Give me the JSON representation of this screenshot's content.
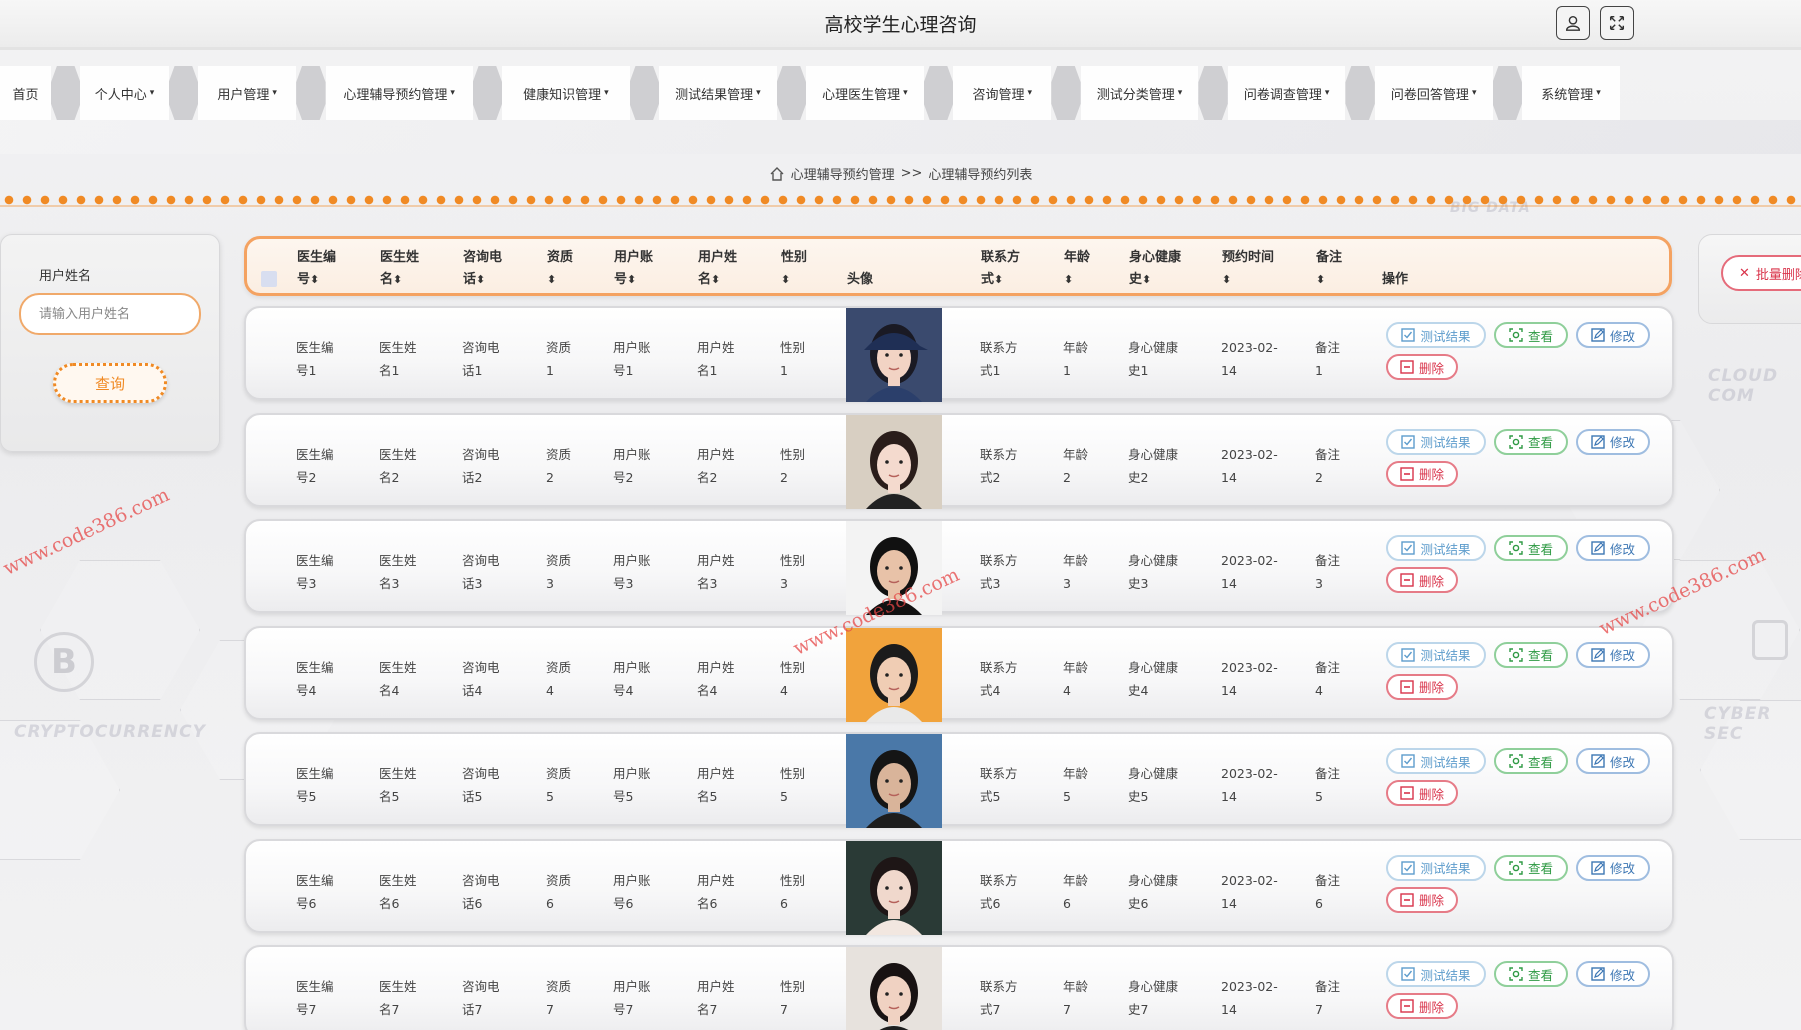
{
  "app": {
    "title": "高校学生心理咨询"
  },
  "nav": [
    {
      "label": "首页",
      "has_caret": false
    },
    {
      "label": "个人中心",
      "has_caret": true
    },
    {
      "label": "用户管理",
      "has_caret": true
    },
    {
      "label": "心理辅导预约管理",
      "has_caret": true
    },
    {
      "label": "健康知识管理",
      "has_caret": true
    },
    {
      "label": "测试结果管理",
      "has_caret": true
    },
    {
      "label": "心理医生管理",
      "has_caret": true
    },
    {
      "label": "咨询管理",
      "has_caret": true
    },
    {
      "label": "测试分类管理",
      "has_caret": true
    },
    {
      "label": "问卷调查管理",
      "has_caret": true
    },
    {
      "label": "问卷回答管理",
      "has_caret": true
    },
    {
      "label": "系统管理",
      "has_caret": true
    }
  ],
  "breadcrumb": {
    "section": "心理辅导预约管理",
    "separator": ">>",
    "page": "心理辅导预约列表"
  },
  "search": {
    "label": "用户姓名",
    "placeholder": "请输入用户姓名",
    "button": "查询"
  },
  "batch_delete": {
    "label": "批量删除"
  },
  "table": {
    "headers": [
      {
        "key": "doc_no",
        "l1": "医生编",
        "l2": "号",
        "sort": true
      },
      {
        "key": "doc_name",
        "l1": "医生姓",
        "l2": "名",
        "sort": true
      },
      {
        "key": "phone",
        "l1": "咨询电",
        "l2": "话",
        "sort": true
      },
      {
        "key": "qual",
        "l1": "资质",
        "l2": "",
        "sort": true
      },
      {
        "key": "user_acc",
        "l1": "用户账",
        "l2": "号",
        "sort": true
      },
      {
        "key": "user_name",
        "l1": "用户姓",
        "l2": "名",
        "sort": true
      },
      {
        "key": "gender",
        "l1": "性别",
        "l2": "",
        "sort": true
      },
      {
        "key": "avatar",
        "l1": "",
        "l2": "头像",
        "sort": false
      },
      {
        "key": "contact",
        "l1": "联系方",
        "l2": "式",
        "sort": true
      },
      {
        "key": "age",
        "l1": "年龄",
        "l2": "",
        "sort": true
      },
      {
        "key": "health",
        "l1": "身心健康",
        "l2": "史",
        "sort": true
      },
      {
        "key": "time",
        "l1": "预约时间",
        "l2": "",
        "sort": true
      },
      {
        "key": "note",
        "l1": "备注",
        "l2": "",
        "sort": true
      },
      {
        "key": "ops",
        "l1": "",
        "l2": "操作",
        "sort": false
      }
    ],
    "rows": [
      {
        "doc_no": "医生编\n号1",
        "doc_name": "医生姓\n名1",
        "phone": "咨询电\n话1",
        "qual": "资质\n1",
        "user_acc": "用户账\n号1",
        "user_name": "用户姓\n名1",
        "gender": "性别\n1",
        "contact": "联系方\n式1",
        "age": "年龄\n1",
        "health": "身心健康\n史1",
        "time": "2023-02-\n14",
        "note": "备注\n1"
      },
      {
        "doc_no": "医生编\n号2",
        "doc_name": "医生姓\n名2",
        "phone": "咨询电\n话2",
        "qual": "资质\n2",
        "user_acc": "用户账\n号2",
        "user_name": "用户姓\n名2",
        "gender": "性别\n2",
        "contact": "联系方\n式2",
        "age": "年龄\n2",
        "health": "身心健康\n史2",
        "time": "2023-02-\n14",
        "note": "备注\n2"
      },
      {
        "doc_no": "医生编\n号3",
        "doc_name": "医生姓\n名3",
        "phone": "咨询电\n话3",
        "qual": "资质\n3",
        "user_acc": "用户账\n号3",
        "user_name": "用户姓\n名3",
        "gender": "性别\n3",
        "contact": "联系方\n式3",
        "age": "年龄\n3",
        "health": "身心健康\n史3",
        "time": "2023-02-\n14",
        "note": "备注\n3"
      },
      {
        "doc_no": "医生编\n号4",
        "doc_name": "医生姓\n名4",
        "phone": "咨询电\n话4",
        "qual": "资质\n4",
        "user_acc": "用户账\n号4",
        "user_name": "用户姓\n名4",
        "gender": "性别\n4",
        "contact": "联系方\n式4",
        "age": "年龄\n4",
        "health": "身心健康\n史4",
        "time": "2023-02-\n14",
        "note": "备注\n4"
      },
      {
        "doc_no": "医生编\n号5",
        "doc_name": "医生姓\n名5",
        "phone": "咨询电\n话5",
        "qual": "资质\n5",
        "user_acc": "用户账\n号5",
        "user_name": "用户姓\n名5",
        "gender": "性别\n5",
        "contact": "联系方\n式5",
        "age": "年龄\n5",
        "health": "身心健康\n史5",
        "time": "2023-02-\n14",
        "note": "备注\n5"
      },
      {
        "doc_no": "医生编\n号6",
        "doc_name": "医生姓\n名6",
        "phone": "咨询电\n话6",
        "qual": "资质\n6",
        "user_acc": "用户账\n号6",
        "user_name": "用户姓\n名6",
        "gender": "性别\n6",
        "contact": "联系方\n式6",
        "age": "年龄\n6",
        "health": "身心健康\n史6",
        "time": "2023-02-\n14",
        "note": "备注\n6"
      },
      {
        "doc_no": "医生编\n号7",
        "doc_name": "医生姓\n名7",
        "phone": "咨询电\n话7",
        "qual": "资质\n7",
        "user_acc": "用户账\n号7",
        "user_name": "用户姓\n名7",
        "gender": "性别\n7",
        "contact": "联系方\n式7",
        "age": "年龄\n7",
        "health": "身心健康\n史7",
        "time": "2023-02-\n14",
        "note": "备注\n7"
      }
    ],
    "actions": {
      "test": "测试结果",
      "view": "查看",
      "edit": "修改",
      "delete": "删除"
    }
  },
  "watermark_text": "www.code386.com",
  "background_texts": [
    "CRYPTOCURRENCY",
    "CLOUD COM",
    "CYBER SEC",
    "BIG DATA"
  ],
  "colors": {
    "accent": "#f08a24",
    "danger": "#d9334a",
    "success": "#2f9a44",
    "info": "#3d77b4"
  }
}
